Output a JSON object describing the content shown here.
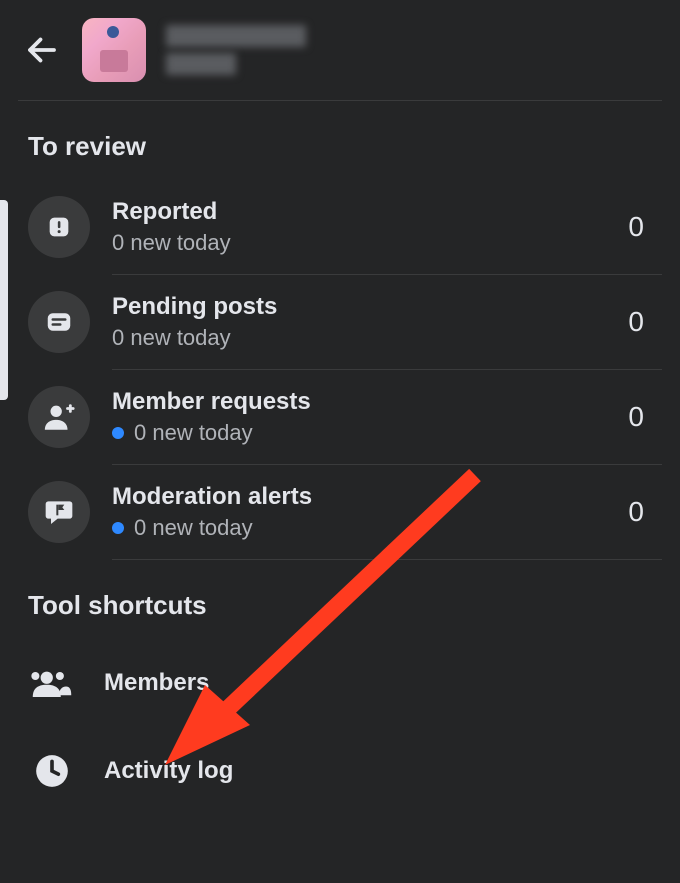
{
  "header": {
    "group_name_redacted": true
  },
  "sections": {
    "to_review": {
      "title": "To review",
      "items": [
        {
          "title": "Reported",
          "subtitle": "0 new today",
          "count": "0",
          "has_dot": false,
          "icon": "exclamation-icon"
        },
        {
          "title": "Pending posts",
          "subtitle": "0 new today",
          "count": "0",
          "has_dot": false,
          "icon": "post-icon"
        },
        {
          "title": "Member requests",
          "subtitle": "0 new today",
          "count": "0",
          "has_dot": true,
          "icon": "person-plus-icon"
        },
        {
          "title": "Moderation alerts",
          "subtitle": "0 new today",
          "count": "0",
          "has_dot": true,
          "icon": "chat-flag-icon"
        }
      ]
    },
    "tool_shortcuts": {
      "title": "Tool shortcuts",
      "items": [
        {
          "title": "Members",
          "icon": "members-icon"
        },
        {
          "title": "Activity log",
          "icon": "clock-icon"
        }
      ]
    }
  },
  "colors": {
    "background": "#242526",
    "text_primary": "#e4e6eb",
    "text_secondary": "#b0b3b8",
    "icon_bg": "#3a3b3c",
    "divider": "#3a3b3c",
    "blue_dot": "#2e89ff",
    "annotation_arrow": "#ff3b1f"
  }
}
